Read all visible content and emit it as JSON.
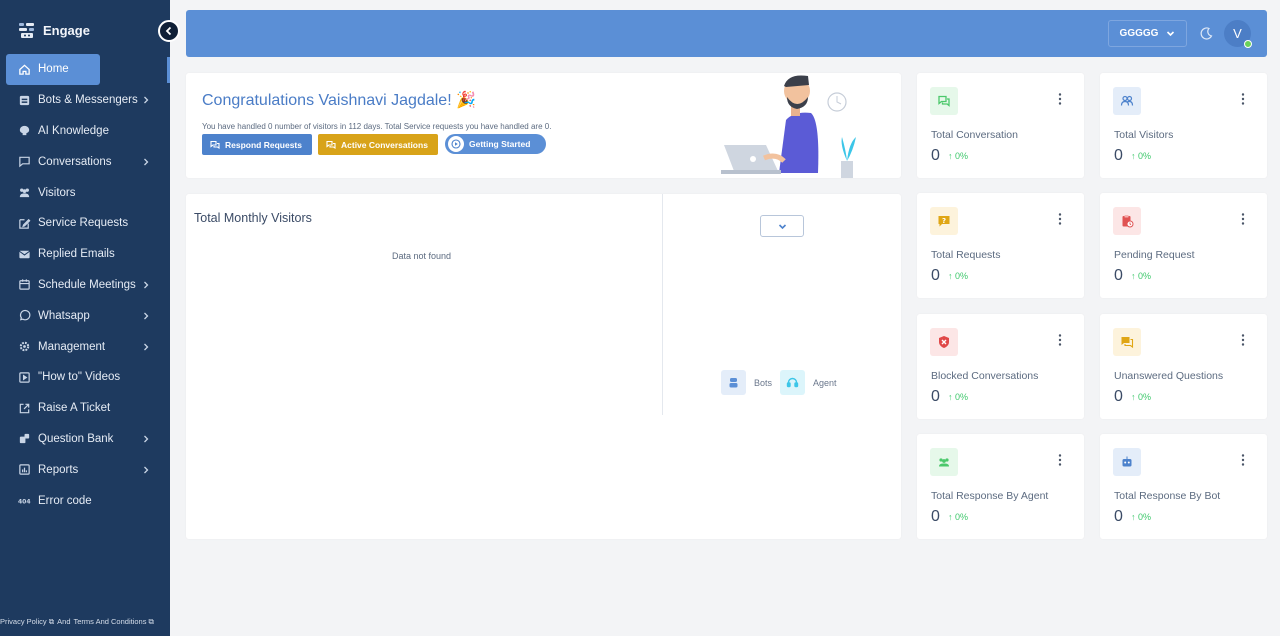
{
  "sidebar": {
    "brand": "Engage",
    "items": [
      {
        "label": "Home",
        "icon": "home-icon",
        "active": true,
        "has_submenu": false
      },
      {
        "label": "Bots & Messengers",
        "icon": "bot-icon",
        "has_submenu": true
      },
      {
        "label": "AI Knowledge",
        "icon": "brain-icon",
        "has_submenu": false
      },
      {
        "label": "Conversations",
        "icon": "chat-icon",
        "has_submenu": true
      },
      {
        "label": "Visitors",
        "icon": "users-icon",
        "has_submenu": false
      },
      {
        "label": "Service Requests",
        "icon": "edit-icon",
        "has_submenu": false
      },
      {
        "label": "Replied Emails",
        "icon": "mail-icon",
        "has_submenu": false
      },
      {
        "label": "Schedule Meetings",
        "icon": "calendar-icon",
        "has_submenu": true
      },
      {
        "label": "Whatsapp",
        "icon": "whatsapp-icon",
        "has_submenu": true
      },
      {
        "label": "Management",
        "icon": "gear-icon",
        "has_submenu": true
      },
      {
        "label": "\"How to\" Videos",
        "icon": "video-icon",
        "has_submenu": false
      },
      {
        "label": "Raise A Ticket",
        "icon": "external-link-icon",
        "has_submenu": false
      },
      {
        "label": "Question Bank",
        "icon": "question-bank-icon",
        "has_submenu": true
      },
      {
        "label": "Reports",
        "icon": "chart-icon",
        "has_submenu": true
      },
      {
        "label": "Error code",
        "icon": "404-icon",
        "has_submenu": false
      }
    ],
    "footer": {
      "privacy": "Privacy Policy",
      "and": "And",
      "terms": "Terms And Conditions"
    }
  },
  "header": {
    "org_select": "GGGGG",
    "avatar_initial": "V"
  },
  "welcome": {
    "title": "Congratulations Vaishnavi Jagdale! 🎉",
    "text": "You have handled 0 number of visitors in 112 days. Total Service requests you have handled are 0.",
    "respond_label": "Respond Requests",
    "active_label": "Active Conversations",
    "started_label": "Getting Started"
  },
  "visitors_panel": {
    "title": "Total Monthly Visitors",
    "empty_text": "Data not found",
    "legend": [
      {
        "label": "Bots",
        "color": "#5b8fd6"
      },
      {
        "label": "Agent",
        "color": "#3cc6e8"
      }
    ]
  },
  "stats": [
    {
      "label": "Total Conversation",
      "value": "0",
      "change": "0%",
      "icon": "chat-bubbles-icon",
      "color": "#4bc86b",
      "bg": "#e6f8ea"
    },
    {
      "label": "Total Visitors",
      "value": "0",
      "change": "0%",
      "icon": "group-icon",
      "color": "#4d82cc",
      "bg": "#e4edf9"
    },
    {
      "label": "Total Requests",
      "value": "0",
      "change": "0%",
      "icon": "question-icon",
      "color": "#e0a614",
      "bg": "#fdf3dc"
    },
    {
      "label": "Pending Request",
      "value": "0",
      "change": "0%",
      "icon": "clipboard-clock-icon",
      "color": "#e05252",
      "bg": "#fce6e6"
    },
    {
      "label": "Blocked Conversations",
      "value": "0",
      "change": "0%",
      "icon": "shield-x-icon",
      "color": "#e04848",
      "bg": "#fce6e6"
    },
    {
      "label": "Unanswered Questions",
      "value": "0",
      "change": "0%",
      "icon": "chat-question-icon",
      "color": "#e0a614",
      "bg": "#fdf3dc"
    },
    {
      "label": "Total Response By Agent",
      "value": "0",
      "change": "0%",
      "icon": "agents-icon",
      "color": "#4bc86b",
      "bg": "#e6f8ea"
    },
    {
      "label": "Total Response By Bot",
      "value": "0",
      "change": "0%",
      "icon": "robot-icon",
      "color": "#4d82cc",
      "bg": "#e4edf9"
    }
  ]
}
